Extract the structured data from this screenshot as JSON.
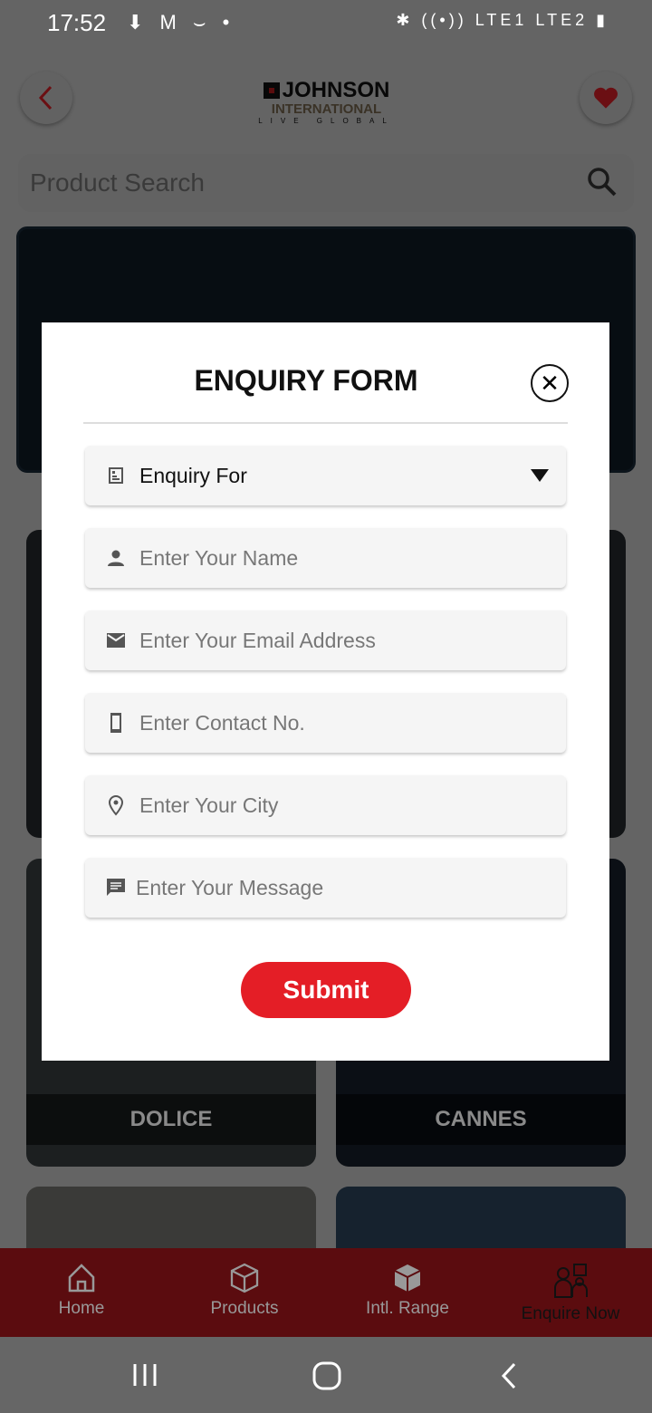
{
  "status_bar": {
    "time": "17:52",
    "left_icons": "⬇ M ⌣ •",
    "right_icons": "✱ ((•)) LTE1 LTE2 ▮"
  },
  "header": {
    "logo": {
      "brand": "JOHNSON",
      "sub": "INTERNATIONAL",
      "tagline": "LIVE GLOBAL"
    }
  },
  "search": {
    "placeholder": "Product Search"
  },
  "cards": [
    {
      "label": "DOLICE"
    },
    {
      "label": "CANNES"
    }
  ],
  "bottom_nav": [
    {
      "label": "Home"
    },
    {
      "label": "Products"
    },
    {
      "label": "Intl. Range"
    },
    {
      "label": "Enquire Now"
    }
  ],
  "modal": {
    "title": "ENQUIRY FORM",
    "fields": [
      {
        "icon": "form-icon",
        "value": "Enquiry For"
      },
      {
        "icon": "person-icon",
        "placeholder": "Enter Your Name"
      },
      {
        "icon": "email-icon",
        "placeholder": "Enter Your Email Address"
      },
      {
        "icon": "phone-icon",
        "placeholder": "Enter Contact No."
      },
      {
        "icon": "location-icon",
        "placeholder": "Enter Your City"
      },
      {
        "icon": "message-icon",
        "placeholder": "Enter Your Message"
      }
    ],
    "submit_label": "Submit"
  },
  "colors": {
    "accent": "#e41e26"
  }
}
